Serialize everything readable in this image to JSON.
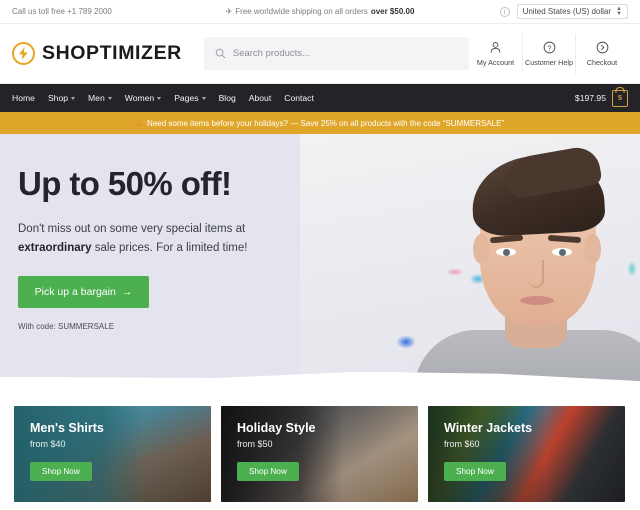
{
  "topbar": {
    "phone": "Call us toll free +1 789 2000",
    "shipping_prefix": "Free worldwide shipping on all orders ",
    "shipping_bold": "over $50.00",
    "plane_icon": "plane-icon",
    "info_icon": "info-icon",
    "currency": "United States (US) dollar"
  },
  "header": {
    "logo_text": "SHOPTIMIZER",
    "logo_icon": "lightning-bolt-icon",
    "logo_color": "#e8a320",
    "search_placeholder": "Search products...",
    "search_icon": "search-icon",
    "actions": [
      {
        "label": "My Account",
        "icon": "user-icon"
      },
      {
        "label": "Customer Help",
        "icon": "question-circle-icon"
      },
      {
        "label": "Checkout",
        "icon": "chevron-right-circle-icon"
      }
    ]
  },
  "nav": {
    "items": [
      {
        "label": "Home",
        "dropdown": false
      },
      {
        "label": "Shop",
        "dropdown": true
      },
      {
        "label": "Men",
        "dropdown": true
      },
      {
        "label": "Women",
        "dropdown": true
      },
      {
        "label": "Pages",
        "dropdown": true
      },
      {
        "label": "Blog",
        "dropdown": false
      },
      {
        "label": "About",
        "dropdown": false
      },
      {
        "label": "Contact",
        "dropdown": false
      }
    ],
    "cart_total": "$197.95",
    "cart_count": "5",
    "cart_icon": "shopping-bag-icon",
    "bar_color": "#242428"
  },
  "promo": {
    "icon": "fire-icon",
    "text": "Need some items before your holidays? — Save 25% on all products with the code “SUMMERSALE”",
    "background": "#e0a62a"
  },
  "hero": {
    "title": "Up to 50% off!",
    "sub_line1": "Don't miss out on some very special items at",
    "sub_bold": "extraordinary",
    "sub_line2": " sale prices. For a limited time!",
    "cta_label": "Pick up a bargain",
    "cta_arrow": "→",
    "cta_color": "#4caf50",
    "code_text": "With code: SUMMERSALE",
    "background": "#e3e4ee"
  },
  "cards": [
    {
      "title": "Men's Shirts",
      "price": "from $40",
      "button": "Shop Now"
    },
    {
      "title": "Holiday Style",
      "price": "from $50",
      "button": "Shop Now"
    },
    {
      "title": "Winter Jackets",
      "price": "from $60",
      "button": "Shop Now"
    }
  ]
}
